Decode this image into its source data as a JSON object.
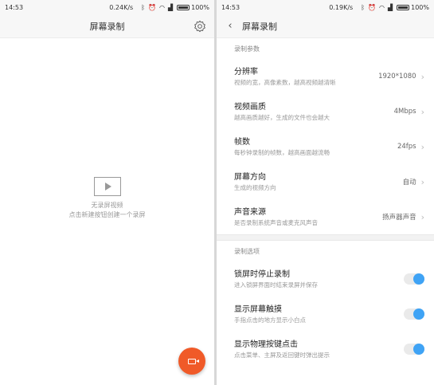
{
  "left_screen": {
    "status_bar": {
      "time": "14:53",
      "net_speed": "0.24K/s",
      "battery": "100%"
    },
    "title": "屏幕录制",
    "empty_state": {
      "line1": "无录屏视频",
      "line2": "点击新建按钮创建一个录屏"
    },
    "icons": {
      "settings": "gear-icon",
      "empty": "video-play-icon",
      "fab": "video-camera-icon"
    },
    "fab_color": "#f05a28"
  },
  "right_screen": {
    "status_bar": {
      "time": "14:53",
      "net_speed": "0.19K/s",
      "battery": "100%"
    },
    "title": "屏幕录制",
    "back_glyph": "‹",
    "params_section": {
      "header": "录制参数",
      "items": [
        {
          "title": "分辨率",
          "subtitle": "视频的宽，高像素数，越高视频越清晰",
          "value": "1920*1080"
        },
        {
          "title": "视频画质",
          "subtitle": "越高画质越好，生成的文件也会越大",
          "value": "4Mbps"
        },
        {
          "title": "帧数",
          "subtitle": "每秒钟录制的帧数，越高画面越流畅",
          "value": "24fps"
        },
        {
          "title": "屏幕方向",
          "subtitle": "生成的视频方向",
          "value": "自动"
        },
        {
          "title": "声音来源",
          "subtitle": "是否录制系统声音或麦克风声音",
          "value": "扬声器声音"
        }
      ]
    },
    "options_section": {
      "header": "录制选项",
      "items": [
        {
          "title": "锁屏时停止录制",
          "subtitle": "进入锁屏界面时结束录屏并保存",
          "enabled": true
        },
        {
          "title": "显示屏幕触摸",
          "subtitle": "手指点击的地方显示小白点",
          "enabled": true
        },
        {
          "title": "显示物理按键点击",
          "subtitle": "点击菜单、主屏及返回键时弹出提示",
          "enabled": true
        }
      ]
    },
    "accent_color": "#3fa3f5"
  }
}
